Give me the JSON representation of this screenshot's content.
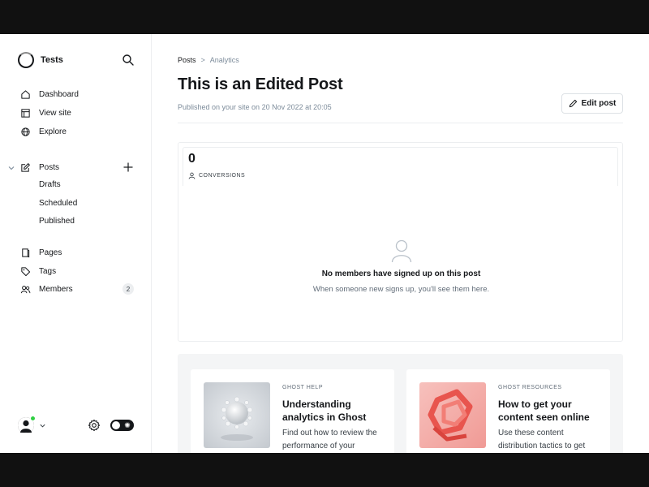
{
  "sidebar": {
    "brand": "Tests",
    "nav_top": [
      "Dashboard",
      "View site",
      "Explore"
    ],
    "posts_label": "Posts",
    "posts_sub": [
      "Drafts",
      "Scheduled",
      "Published"
    ],
    "nav_bottom": [
      "Pages",
      "Tags",
      "Members"
    ],
    "members_count": "2"
  },
  "breadcrumb": {
    "parent": "Posts",
    "separator": ">",
    "current": "Analytics"
  },
  "header": {
    "title": "This is an Edited Post",
    "published": "Published on your site on 20 Nov 2022 at 20:05",
    "edit_label": "Edit post"
  },
  "stats": {
    "conversions_value": "0",
    "conversions_label": "CONVERSIONS",
    "empty_title": "No members have signed up on this post",
    "empty_text": "When someone new signs up, you'll see them here."
  },
  "resources": [
    {
      "category": "GHOST HELP",
      "title": "Understanding analytics in Ghost",
      "description": "Find out how to review the performance of your"
    },
    {
      "category": "GHOST RESOURCES",
      "title": "How to get your content seen online",
      "description": "Use these content distribution tactics to get"
    }
  ],
  "colors": {
    "accent_green": "#30cf43",
    "text": "#15171a",
    "muted": "#7c8b9a"
  }
}
